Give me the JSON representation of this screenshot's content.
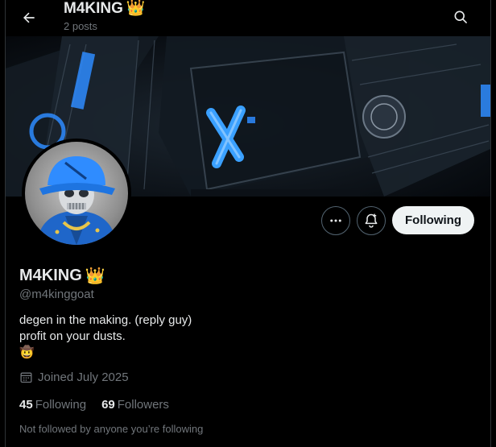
{
  "header": {
    "title": "M4KING",
    "title_emoji": "👑",
    "post_count": "2 posts"
  },
  "icons": {
    "back": "arrow-left-icon",
    "search": "search-icon",
    "more": "more-dots-icon",
    "notifications": "bell-plus-icon",
    "calendar": "calendar-icon",
    "crown": "crown-emoji",
    "cowboy": "cowboy-emoji"
  },
  "profile": {
    "display_name": "M4KING",
    "name_emoji": "👑",
    "handle": "@m4kinggoat",
    "bio_line1": "degen in the making. (reply guy)",
    "bio_line2": "profit on your dusts.",
    "bio_emoji": "🤠",
    "joined": "Joined July 2025",
    "following_count": "45",
    "following_label": "Following",
    "followers_count": "69",
    "followers_label": "Followers",
    "mutuals_note": "Not followed by anyone you’re following"
  },
  "actions": {
    "following_button": "Following"
  },
  "colors": {
    "background": "#000000",
    "primary_text": "#e7e9ea",
    "secondary_text": "#71767b",
    "button_bg": "#eff3f4",
    "accent_blue": "#2f8cff"
  }
}
